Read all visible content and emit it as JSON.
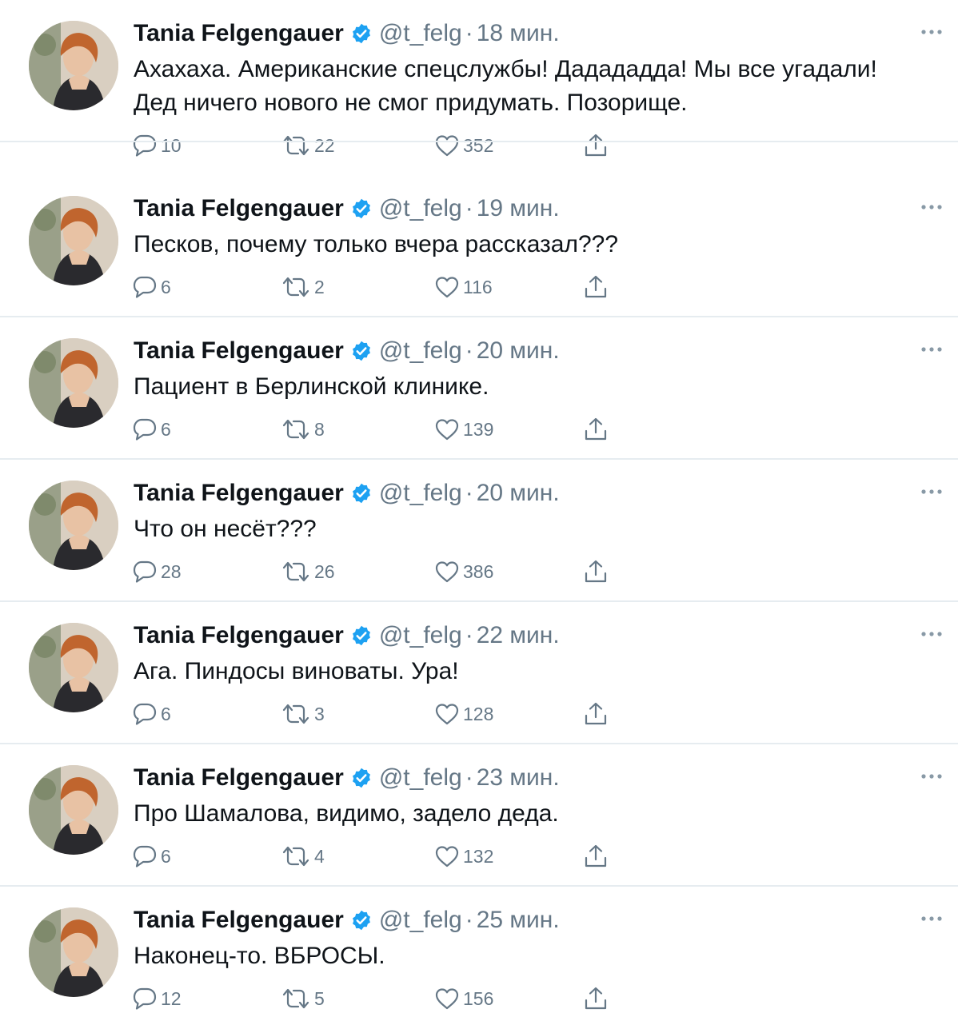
{
  "colors": {
    "text": "#0f1419",
    "secondary": "#657786",
    "verified": "#1da1f2",
    "divider": "#e6ecf0"
  },
  "icons": {
    "reply": "speech-bubble-icon",
    "retweet": "retweet-arrows-icon",
    "like": "heart-icon",
    "share": "share-upload-icon",
    "more": "ellipsis-icon",
    "verified": "verified-badge-icon"
  },
  "tweets": [
    {
      "author": "Tania Felgengauer",
      "handle": "@t_felg",
      "separator": "·",
      "time": "18 мин.",
      "text": "Ахахаха. Американские спецслужбы! Дадададда! Мы все угадали! Дед ничего нового не смог придумать. Позорище.",
      "replies": "10",
      "retweets": "22",
      "likes": "352"
    },
    {
      "author": "Tania Felgengauer",
      "handle": "@t_felg",
      "separator": "·",
      "time": "19 мин.",
      "text": "Песков, почему только вчера рассказал???",
      "replies": "6",
      "retweets": "2",
      "likes": "116"
    },
    {
      "author": "Tania Felgengauer",
      "handle": "@t_felg",
      "separator": "·",
      "time": "20 мин.",
      "text": "Пациент в Берлинской клинике.",
      "replies": "6",
      "retweets": "8",
      "likes": "139"
    },
    {
      "author": "Tania Felgengauer",
      "handle": "@t_felg",
      "separator": "·",
      "time": "20 мин.",
      "text": "Что он несёт???",
      "replies": "28",
      "retweets": "26",
      "likes": "386"
    },
    {
      "author": "Tania Felgengauer",
      "handle": "@t_felg",
      "separator": "·",
      "time": "22 мин.",
      "text": "Ага. Пиндосы виноваты. Ура!",
      "replies": "6",
      "retweets": "3",
      "likes": "128"
    },
    {
      "author": "Tania Felgengauer",
      "handle": "@t_felg",
      "separator": "·",
      "time": "23 мин.",
      "text": "Про Шамалова, видимо, задело деда.",
      "replies": "6",
      "retweets": "4",
      "likes": "132"
    },
    {
      "author": "Tania Felgengauer",
      "handle": "@t_felg",
      "separator": "·",
      "time": "25 мин.",
      "text": "Наконец-то. ВБРОСЫ.",
      "replies": "12",
      "retweets": "5",
      "likes": "156"
    }
  ]
}
